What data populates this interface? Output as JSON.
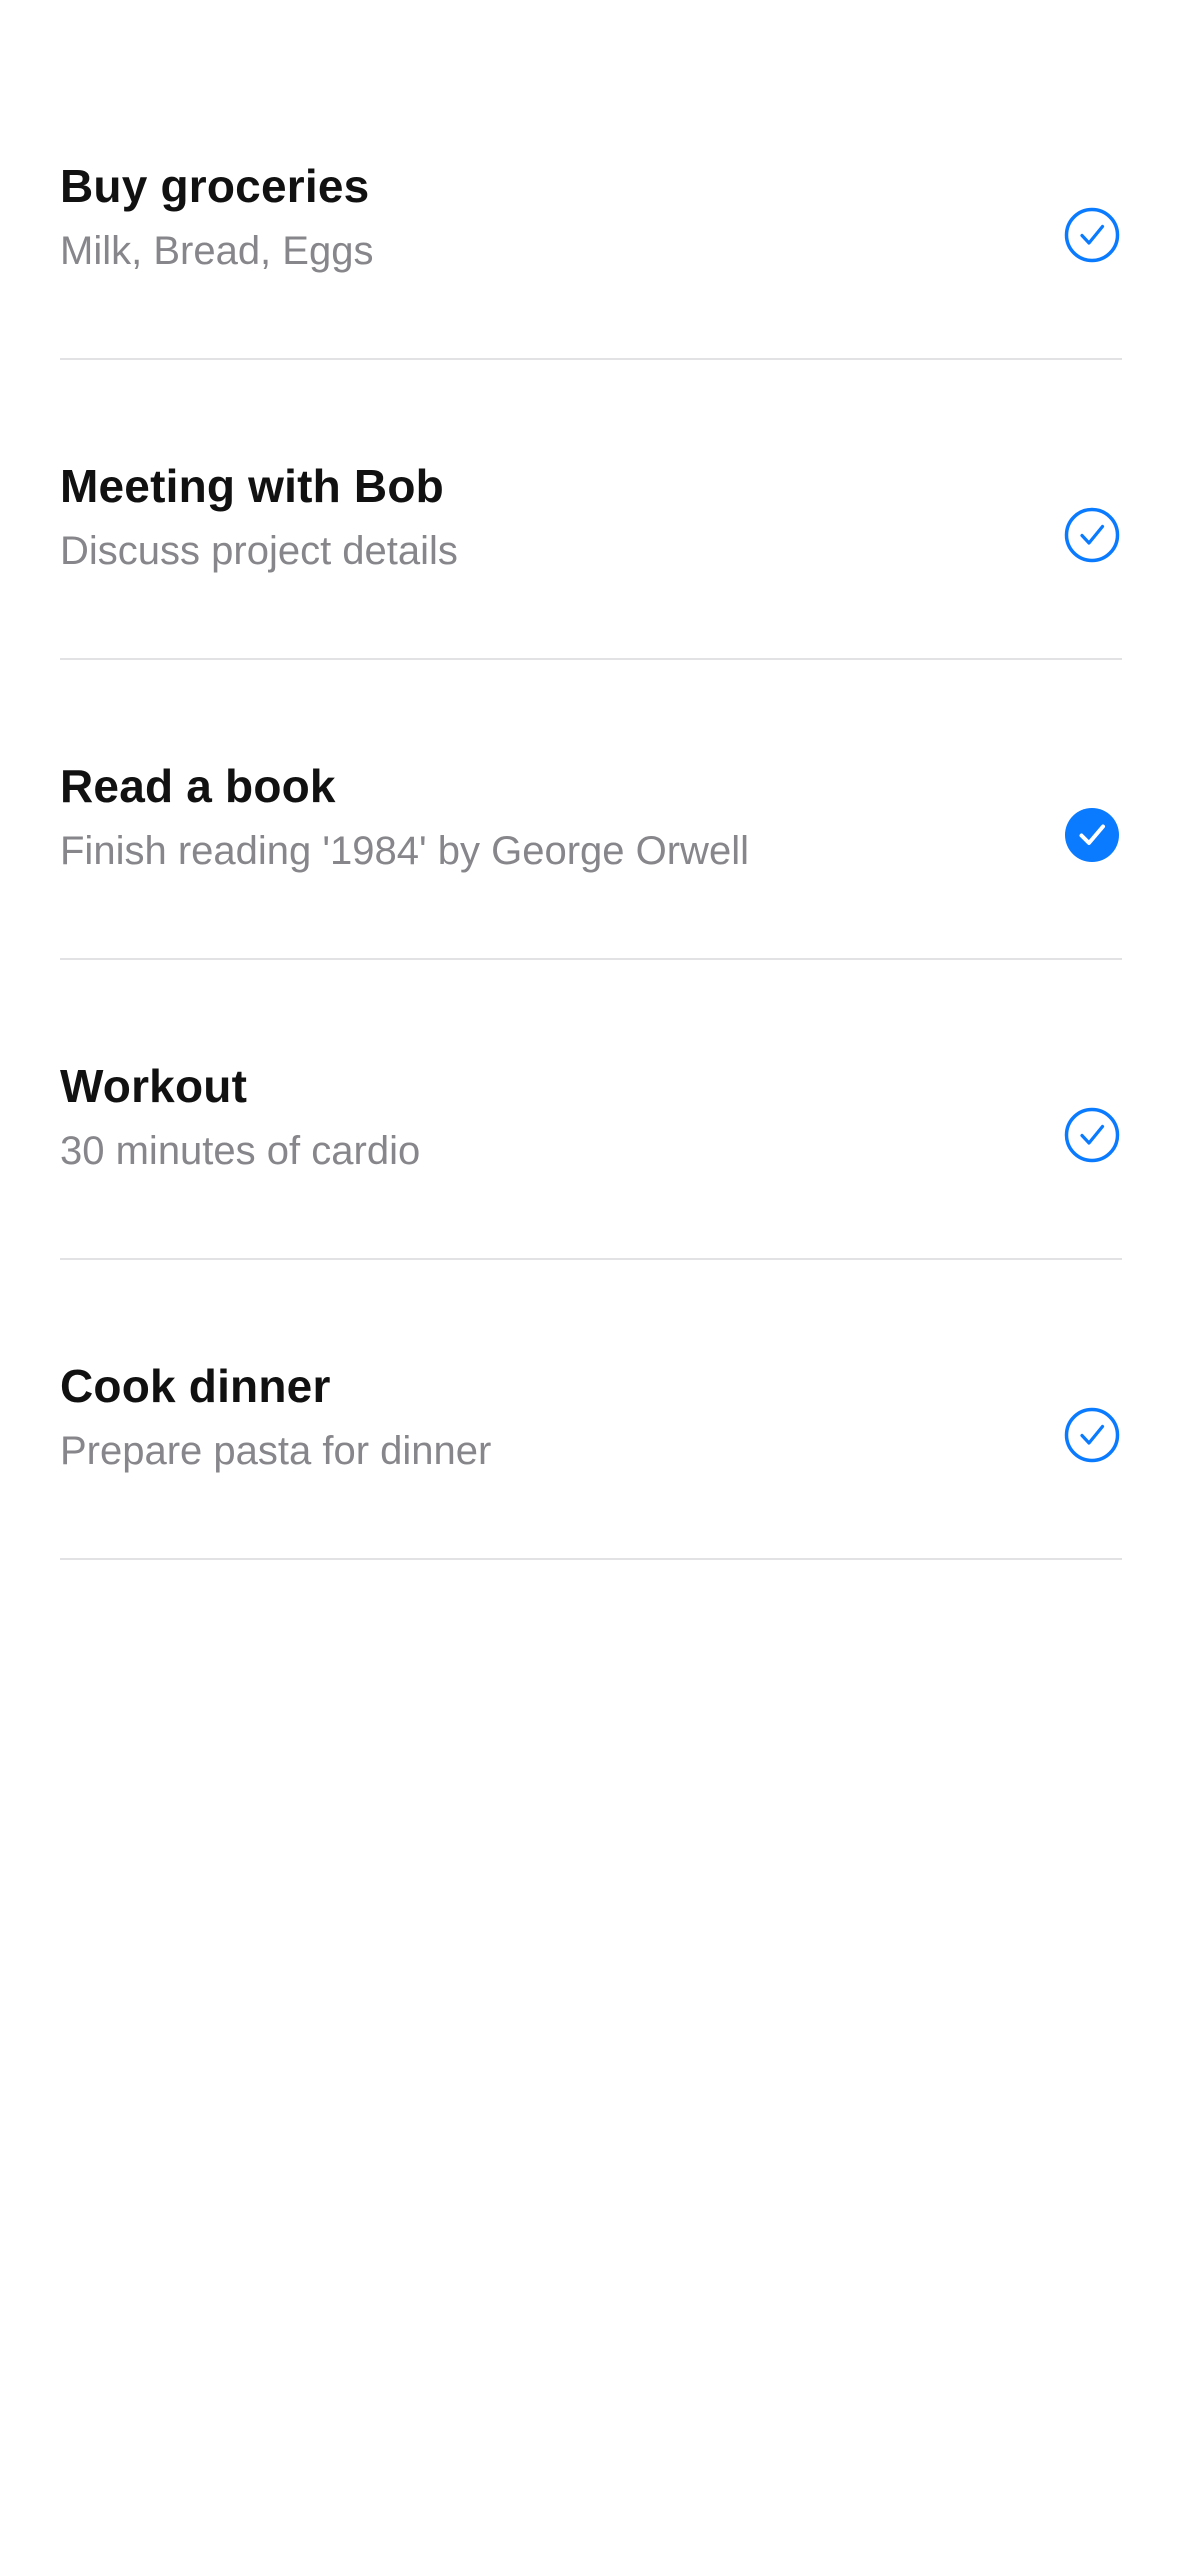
{
  "colors": {
    "accent": "#0a7aff",
    "title": "#111111",
    "subtitle": "#86868b",
    "divider": "#e2e2e4"
  },
  "tasks": [
    {
      "title": "Buy groceries",
      "subtitle": "Milk, Bread, Eggs",
      "completed": false,
      "icon": "checkmark-circle-icon"
    },
    {
      "title": "Meeting with Bob",
      "subtitle": "Discuss project details",
      "completed": false,
      "icon": "checkmark-circle-icon"
    },
    {
      "title": "Read a book",
      "subtitle": "Finish reading '1984' by George Orwell",
      "completed": true,
      "icon": "checkmark-circle-fill-icon"
    },
    {
      "title": "Workout",
      "subtitle": "30 minutes of cardio",
      "completed": false,
      "icon": "checkmark-circle-icon"
    },
    {
      "title": "Cook dinner",
      "subtitle": "Prepare pasta for dinner",
      "completed": false,
      "icon": "checkmark-circle-icon"
    }
  ]
}
